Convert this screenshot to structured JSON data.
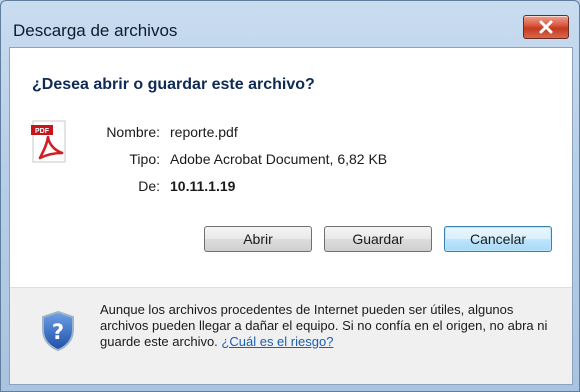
{
  "window": {
    "title": "Descarga de archivos"
  },
  "dialog": {
    "question": "¿Desea abrir o guardar este archivo?",
    "file_icon": "pdf-icon",
    "fields": {
      "name_label": "Nombre:",
      "name_value": "reporte.pdf",
      "type_label": "Tipo:",
      "type_value": "Adobe Acrobat Document, 6,82 KB",
      "from_label": "De:",
      "from_value": "10.11.1.19"
    },
    "buttons": {
      "open": "Abrir",
      "save": "Guardar",
      "cancel": "Cancelar"
    }
  },
  "footer": {
    "icon": "shield-question-icon",
    "text": "Aunque los archivos procedentes de Internet pueden ser útiles, algunos archivos pueden llegar a dañar el equipo. Si no confía en el origen, no abra ni guarde este archivo.",
    "link": "¿Cuál es el riesgo?"
  },
  "colors": {
    "title_bg": "#b8cfe8",
    "close_button": "#c33a22",
    "question_text": "#0f2a55",
    "link": "#1a5fb4",
    "default_button": "#a7d9f5"
  }
}
